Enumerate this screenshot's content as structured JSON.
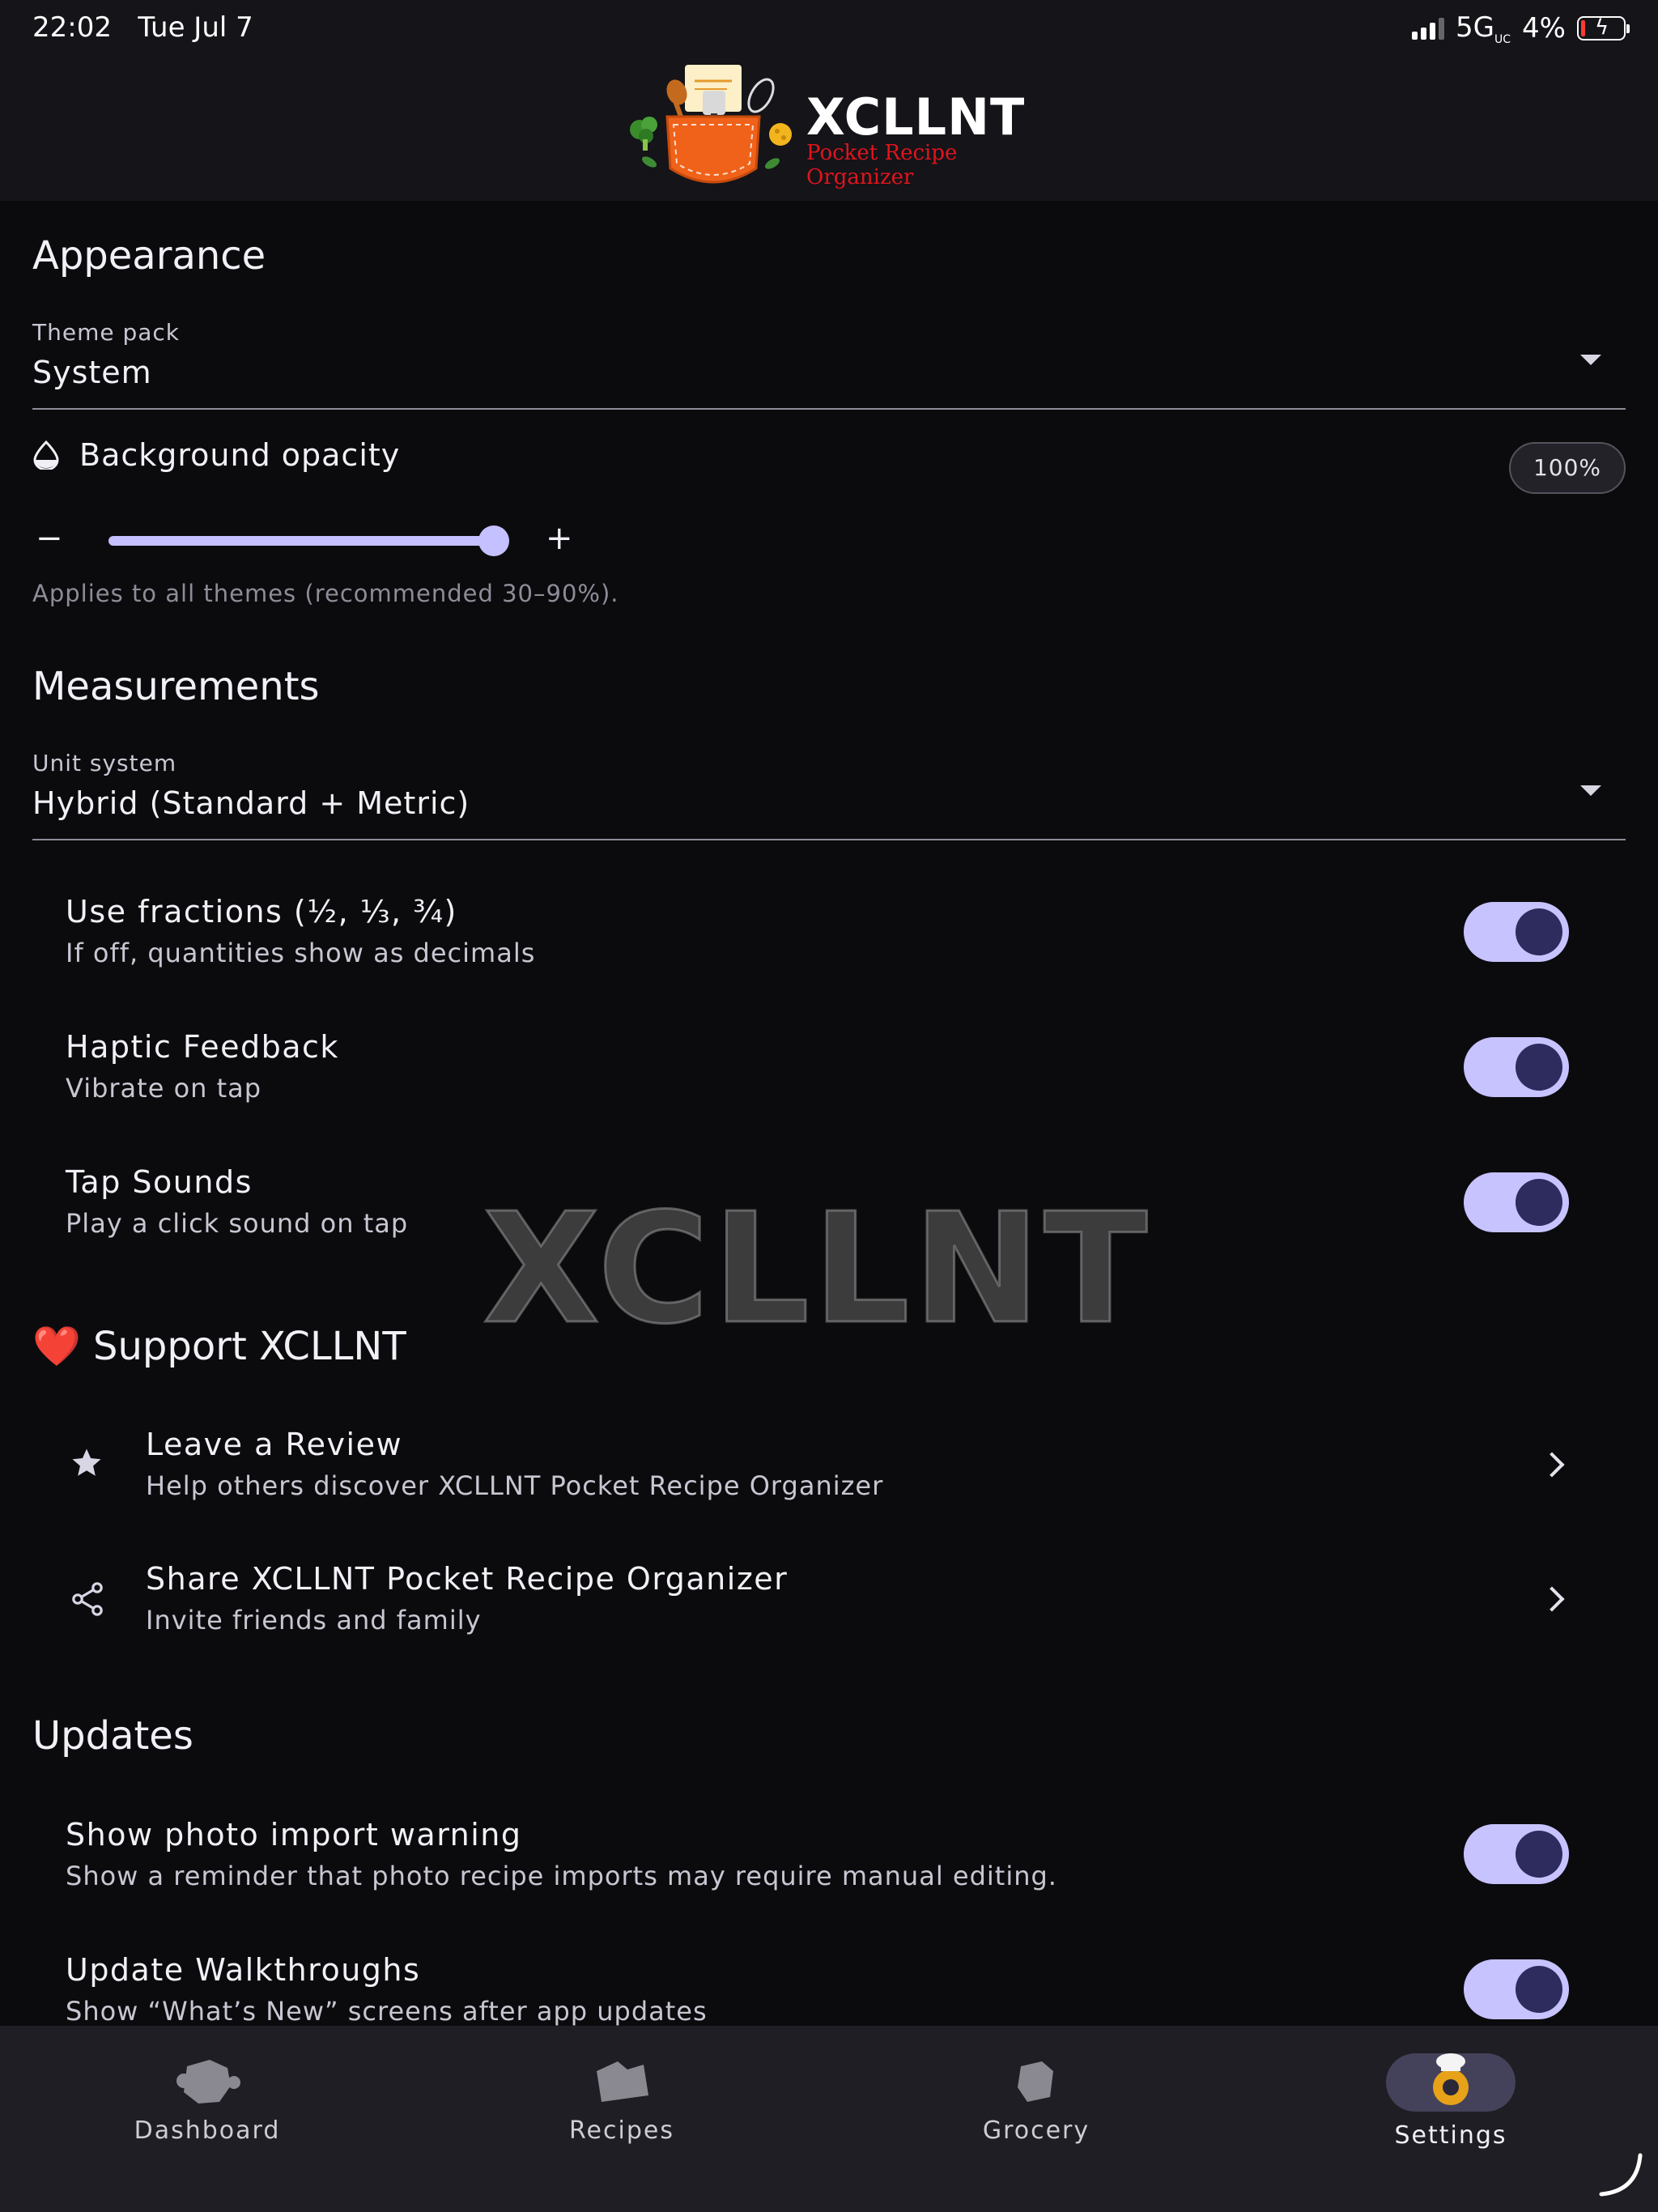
{
  "status_bar": {
    "time": "22:02",
    "date": "Tue Jul 7",
    "network": "5G",
    "network_suffix": "UC",
    "battery": "4%"
  },
  "header": {
    "brand": "XCLLNT",
    "tagline": "Pocket Recipe Organizer"
  },
  "appearance": {
    "title": "Appearance",
    "theme_label": "Theme pack",
    "theme_value": "System",
    "opacity_label": "Background opacity",
    "opacity_value": "100%",
    "opacity_level": 1.0,
    "minus": "−",
    "plus": "+",
    "hint": "Applies to all themes (recommended 30–90%)."
  },
  "measurements": {
    "title": "Measurements",
    "unit_label": "Unit system",
    "unit_value": "Hybrid (Standard + Metric)",
    "toggles": [
      {
        "title": "Use fractions (½, ⅓, ¾)",
        "subtitle": "If off, quantities show as decimals",
        "on": true
      },
      {
        "title": "Haptic Feedback",
        "subtitle": "Vibrate on tap",
        "on": true
      },
      {
        "title": "Tap Sounds",
        "subtitle": "Play a click sound on tap",
        "on": true
      }
    ]
  },
  "watermark": "XCLLNT",
  "support": {
    "heart": "❤️",
    "title": "Support XCLLNT",
    "items": [
      {
        "icon": "star-icon",
        "title": "Leave a Review",
        "subtitle": "Help others discover XCLLNT Pocket Recipe Organizer"
      },
      {
        "icon": "share-icon",
        "title": "Share XCLLNT Pocket Recipe Organizer",
        "subtitle": "Invite friends and family"
      }
    ]
  },
  "updates": {
    "title": "Updates",
    "toggles": [
      {
        "title": "Show photo import warning",
        "subtitle": "Show a reminder that photo recipe imports may require manual editing.",
        "on": true
      },
      {
        "title": "Update Walkthroughs",
        "subtitle": "Show “What’s New” screens after app updates",
        "on": true
      }
    ]
  },
  "bottom_nav": [
    {
      "label": "Dashboard",
      "icon": "dashboard-icon",
      "active": false
    },
    {
      "label": "Recipes",
      "icon": "recipes-icon",
      "active": false
    },
    {
      "label": "Grocery",
      "icon": "grocery-icon",
      "active": false
    },
    {
      "label": "Settings",
      "icon": "settings-chef-icon",
      "active": true
    }
  ],
  "colors": {
    "accent": "#c5c0ff",
    "knob": "#2e2b5e",
    "background": "#0b0b0e",
    "header": "#141419",
    "brand_red": "#e2141c"
  }
}
